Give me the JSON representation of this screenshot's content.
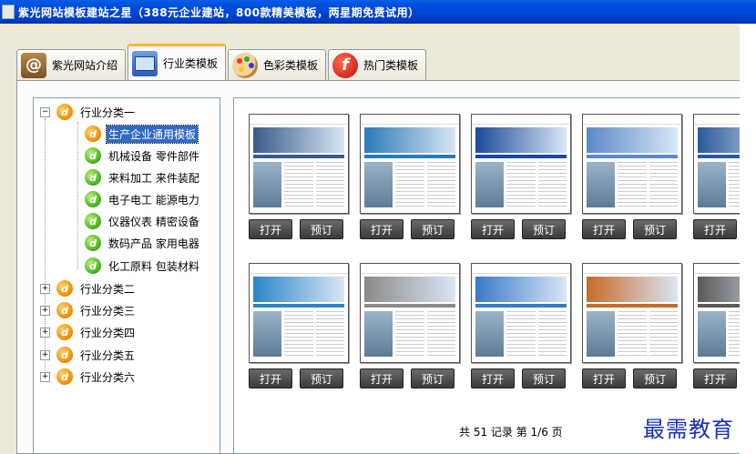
{
  "window": {
    "title": "紫光网站模板建站之星（388元企业建站，800款精美模板，两星期免费试用）"
  },
  "tabs": [
    {
      "label": "紫光网站介绍",
      "icon": "at-sign-icon",
      "active": false
    },
    {
      "label": "行业类模板",
      "icon": "monitor-icon",
      "active": true
    },
    {
      "label": "色彩类模板",
      "icon": "palette-icon",
      "active": false
    },
    {
      "label": "热门类模板",
      "icon": "flash-icon",
      "active": false
    }
  ],
  "tree": {
    "category1": {
      "label": "行业分类一",
      "expander": "−",
      "children": [
        {
          "label": "生产企业通用模板",
          "selected": true
        },
        {
          "label": "机械设备 零件部件"
        },
        {
          "label": "来料加工 来件装配"
        },
        {
          "label": "电子电工 能源电力"
        },
        {
          "label": "仪器仪表 精密设备"
        },
        {
          "label": "数码产品 家用电器"
        },
        {
          "label": "化工原料 包装材料"
        }
      ]
    },
    "collapsed": [
      {
        "label": "行业分类二",
        "expander": "+"
      },
      {
        "label": "行业分类三",
        "expander": "+"
      },
      {
        "label": "行业分类四",
        "expander": "+"
      },
      {
        "label": "行业分类五",
        "expander": "+"
      },
      {
        "label": "行业分类六",
        "expander": "+"
      }
    ]
  },
  "templates": {
    "open_label": "打开",
    "order_label": "预订",
    "row1_palettes": [
      "#3a5a8a",
      "#2a7ab8",
      "#1a4a9a",
      "#5a8ac8",
      "#2a5a9a"
    ],
    "row2_palettes": [
      "#2a86c8",
      "#8a8a8a",
      "#3a7ac8",
      "#c86a2a",
      "#5a5a5a"
    ]
  },
  "pager": {
    "text": "共 51 记录  第 1/6 页"
  },
  "watermark": "最需教育"
}
